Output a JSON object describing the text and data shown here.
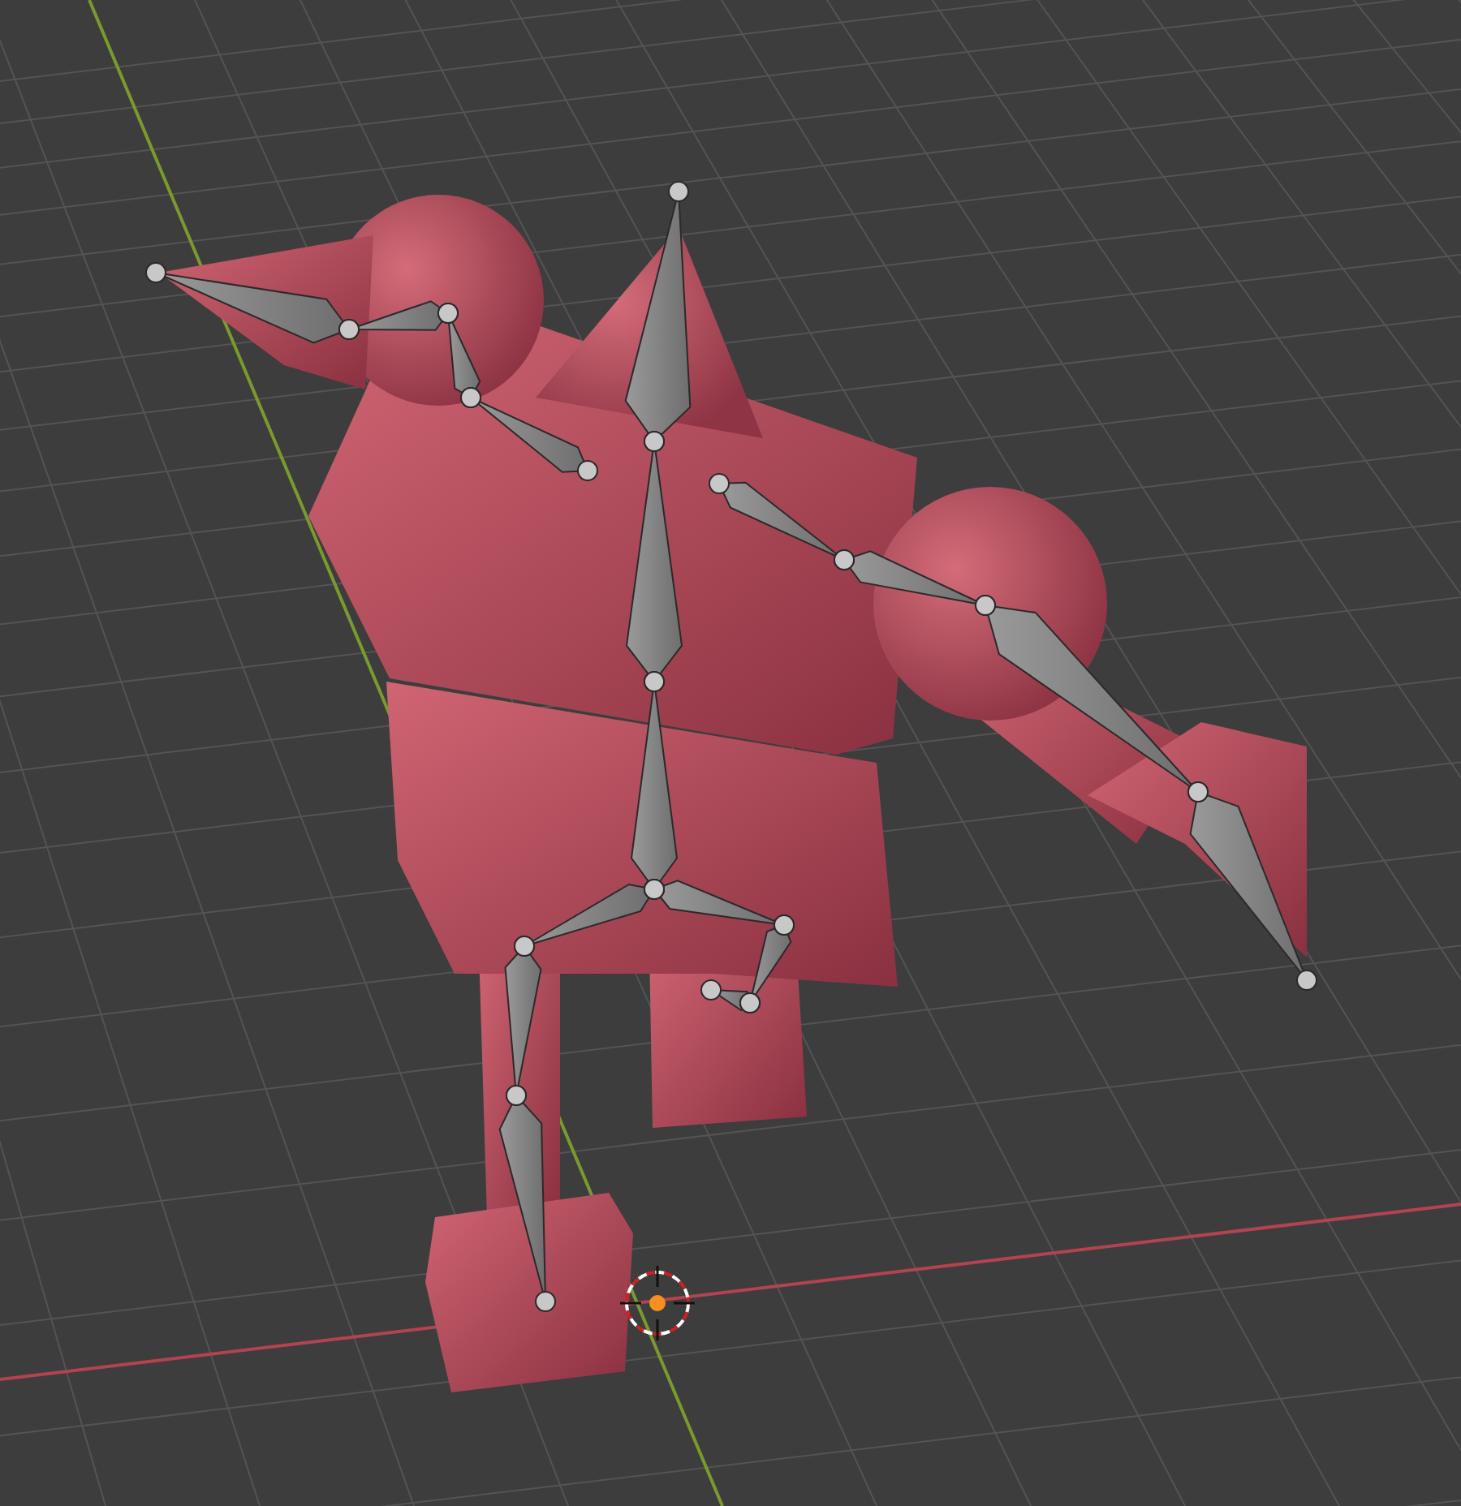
{
  "viewport": {
    "show_grid": true,
    "show_axes": true,
    "show_armature": true,
    "show_cursor": true
  }
}
